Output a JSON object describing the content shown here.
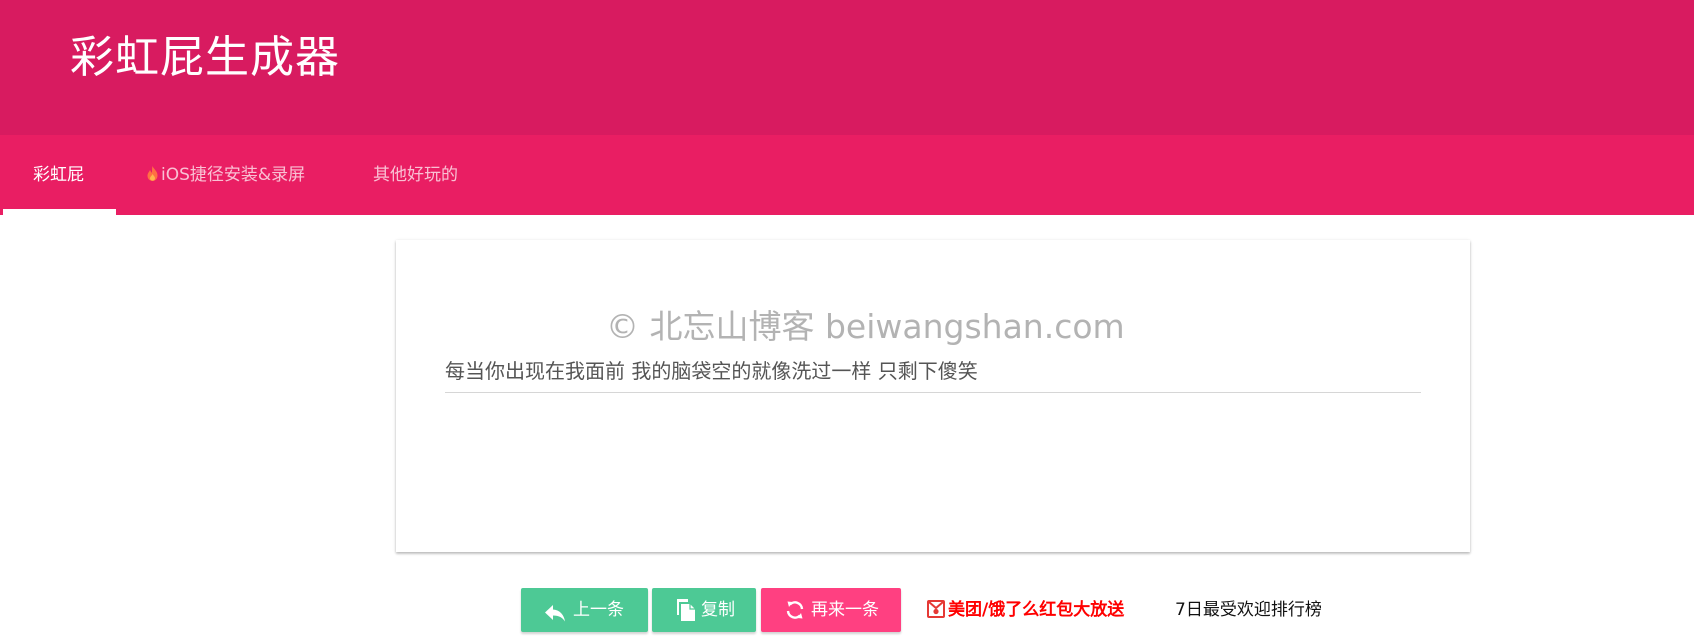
{
  "app": {
    "title": "彩虹屁生成器"
  },
  "tabs": [
    {
      "label": "彩虹屁",
      "icon": "",
      "active": true
    },
    {
      "label": "iOS捷径安装&录屏",
      "icon": "fire-icon",
      "active": false
    },
    {
      "label": "其他好玩的",
      "icon": "",
      "active": false
    }
  ],
  "card": {
    "watermark": "© 北忘山博客 beiwangshan.com",
    "text": "每当你出现在我面前 我的脑袋空的就像洗过一样 只剩下傻笑"
  },
  "actions": {
    "prev_label": "上一条",
    "prev_icon": "reply-arrow-icon",
    "copy_label": "复制",
    "copy_icon": "copy-icon",
    "next_label": "再来一条",
    "next_icon": "refresh-icon",
    "promo_label": "美团/饿了么红包大放送",
    "promo_icon": "red-envelope-icon",
    "rank_label": "7日最受欢迎排行榜"
  },
  "colors": {
    "header": "#d81b60",
    "tabbar": "#e91e63",
    "primary_button": "#4dc995",
    "accent_button": "#ff4081",
    "promo_text": "#ff0000"
  }
}
